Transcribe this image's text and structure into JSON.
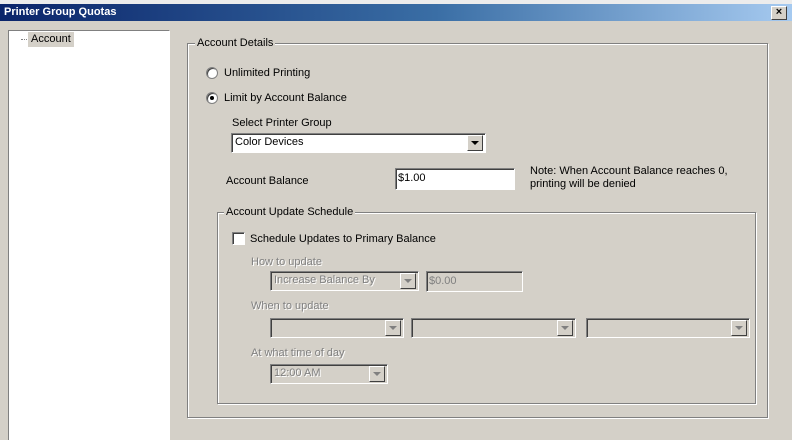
{
  "window": {
    "title": "Printer Group Quotas",
    "close_glyph": "×"
  },
  "tree": {
    "items": [
      {
        "label": "Account"
      }
    ]
  },
  "account_details": {
    "legend": "Account Details",
    "unlimited_label": "Unlimited Printing",
    "limit_label": "Limit by Account Balance",
    "selected_option": "limit",
    "printer_group_label": "Select Printer Group",
    "printer_group_value": "Color Devices",
    "balance_label": "Account Balance",
    "balance_value": "$1.00",
    "note_line1": "Note: When Account Balance reaches 0,",
    "note_line2": "printing will be denied"
  },
  "schedule": {
    "legend": "Account Update Schedule",
    "checkbox_label": "Schedule Updates to Primary Balance",
    "checked": false,
    "how_label": "How to update",
    "how_value": "Increase Balance By",
    "how_amount": "$0.00",
    "when_label": "When to update",
    "when_values": [
      "",
      "",
      ""
    ],
    "time_label": "At what time of day",
    "time_value": "12:00 AM"
  }
}
